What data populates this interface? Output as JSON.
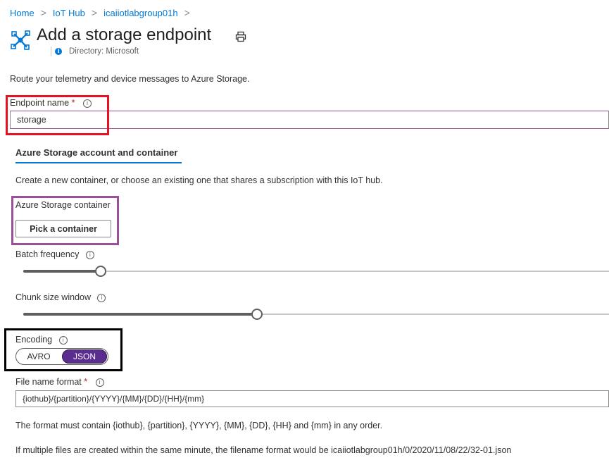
{
  "breadcrumb": {
    "items": [
      "Home",
      "IoT Hub",
      "icaiiotlabgroup01h"
    ],
    "separator": ">"
  },
  "header": {
    "title": "Add a storage endpoint",
    "directory": "Directory: Microsoft"
  },
  "description": "Route your telemetry and device messages to Azure Storage.",
  "endpoint": {
    "label": "Endpoint name",
    "required_mark": "*",
    "value": "storage"
  },
  "tab": {
    "label": "Azure Storage account and container"
  },
  "container": {
    "info": "Create a new container, or choose an existing one that shares a subscription with this IoT hub.",
    "label": "Azure Storage container",
    "button": "Pick a container"
  },
  "batch": {
    "label": "Batch frequency",
    "level": 0.13
  },
  "chunk": {
    "label": "Chunk size window",
    "level": 0.4
  },
  "encoding": {
    "label": "Encoding",
    "options": [
      "AVRO",
      "JSON"
    ],
    "selected": "JSON"
  },
  "file_format": {
    "label": "File name format",
    "required_mark": "*",
    "value": "{iothub}/{partition}/{YYYY}/{MM}/{DD}/{HH}/{mm}",
    "note": "The format must contain {iothub}, {partition}, {YYYY}, {MM}, {DD}, {HH} and {mm} in any order.",
    "example": "If multiple files are created within the same minute, the filename format would be icaiiotlabgroup01h/0/2020/11/08/22/32-01.json"
  },
  "colors": {
    "accent": "#0078d4",
    "toggle_on": "#5c2d91",
    "highlight_red": "#e81123",
    "highlight_purple": "#9b4f96",
    "highlight_black": "#000000"
  },
  "icons": {
    "page": "iot-hub-icon",
    "print": "print-icon",
    "info": "info-icon"
  }
}
